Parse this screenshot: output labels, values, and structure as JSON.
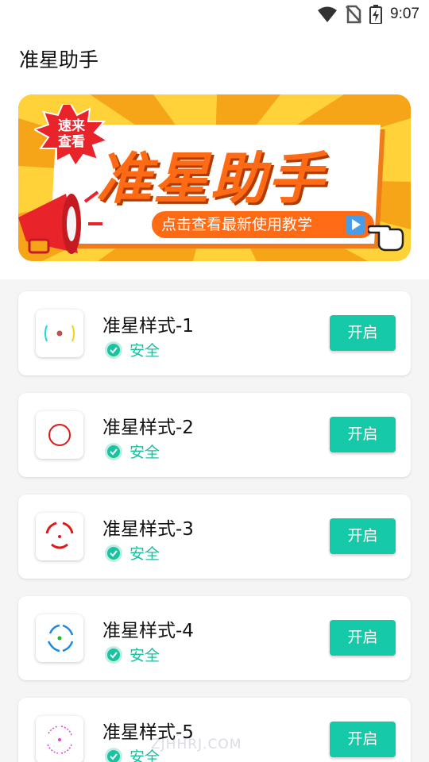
{
  "status_bar": {
    "time": "9:07"
  },
  "app": {
    "title": "准星助手"
  },
  "banner": {
    "badge": "速来查看",
    "title": "准星助手",
    "cta": "点击查看最新使用教学"
  },
  "items": [
    {
      "name": "准星样式-1",
      "safe": "安全",
      "button": "开启"
    },
    {
      "name": "准星样式-2",
      "safe": "安全",
      "button": "开启"
    },
    {
      "name": "准星样式-3",
      "safe": "安全",
      "button": "开启"
    },
    {
      "name": "准星样式-4",
      "safe": "安全",
      "button": "开启"
    },
    {
      "name": "准星样式-5",
      "safe": "安全",
      "button": "开启"
    }
  ],
  "watermark": "ZJHHRJ.COM",
  "colors": {
    "accent": "#15c9a9",
    "safe_text": "#18c0a0",
    "banner_orange": "#ff6a14",
    "banner_yellow": "#f7b21c"
  }
}
